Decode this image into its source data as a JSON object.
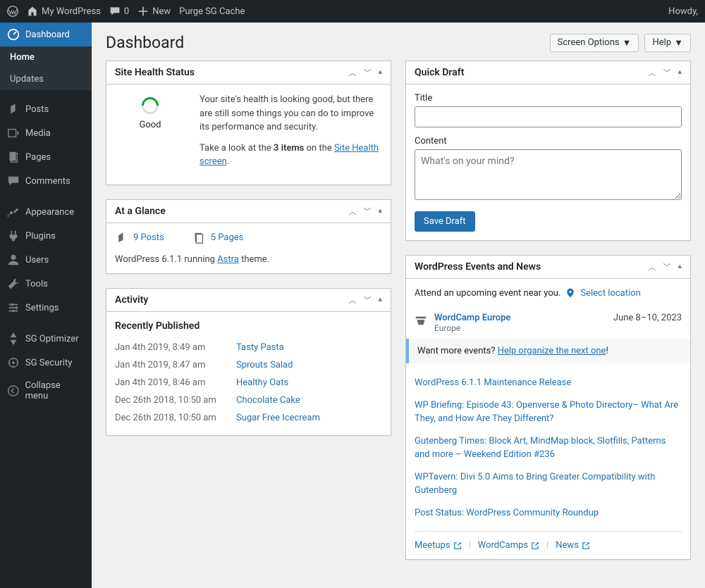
{
  "adminbar": {
    "site_name": "My WordPress",
    "comments_count": "0",
    "new_label": "New",
    "purge_label": "Purge SG Cache",
    "howdy": "Howdy,"
  },
  "sidebar": {
    "dashboard": "Dashboard",
    "home": "Home",
    "updates": "Updates",
    "posts": "Posts",
    "media": "Media",
    "pages": "Pages",
    "comments": "Comments",
    "appearance": "Appearance",
    "plugins": "Plugins",
    "users": "Users",
    "tools": "Tools",
    "settings": "Settings",
    "sg_optimizer": "SG Optimizer",
    "sg_security": "SG Security",
    "collapse": "Collapse menu"
  },
  "page": {
    "title": "Dashboard",
    "screen_options": "Screen Options",
    "help": "Help"
  },
  "site_health": {
    "title": "Site Health Status",
    "status": "Good",
    "p1": "Your site's health is looking good, but there are still some things you can do to improve its performance and security.",
    "p2_prefix": "Take a look at the ",
    "p2_bold": "3 items",
    "p2_mid": " on the ",
    "p2_link": "Site Health screen",
    "p2_suffix": "."
  },
  "glance": {
    "title": "At a Glance",
    "posts": "9 Posts",
    "pages": "5 Pages",
    "wp_prefix": "WordPress 6.1.1 running ",
    "theme": "Astra",
    "wp_suffix": " theme."
  },
  "activity": {
    "title": "Activity",
    "heading": "Recently Published",
    "items": [
      {
        "date": "Jan 4th 2019, 8:49 am",
        "title": "Tasty Pasta"
      },
      {
        "date": "Jan 4th 2019, 8:47 am",
        "title": "Sprouts Salad"
      },
      {
        "date": "Jan 4th 2019, 8:46 am",
        "title": "Healthy Oats"
      },
      {
        "date": "Dec 26th 2018, 10:50 am",
        "title": "Chocolate Cake"
      },
      {
        "date": "Dec 26th 2018, 10:50 am",
        "title": "Sugar Free Icecream"
      }
    ]
  },
  "quick_draft": {
    "title": "Quick Draft",
    "title_label": "Title",
    "content_label": "Content",
    "content_placeholder": "What's on your mind?",
    "save_btn": "Save Draft"
  },
  "events": {
    "title": "WordPress Events and News",
    "attend": "Attend an upcoming event near you.",
    "select_location": "Select location",
    "event_title": "WordCamp Europe",
    "event_location": "Europe",
    "event_date": "June 8–10, 2023",
    "more_prefix": "Want more events? ",
    "more_link": "Help organize the next one",
    "more_suffix": "!",
    "news": [
      "WordPress 6.1.1 Maintenance Release",
      "WP Briefing: Episode 43: Openverse & Photo Directory– What Are They, and How Are They Different?",
      "Gutenberg Times: Block Art, MindMap block, Slotfills, Patterns and more – Weekend Edition #236",
      "WPTavern: Divi 5.0 Aims to Bring Greater Compatibility with Gutenberg",
      "Post Status: WordPress Community Roundup"
    ],
    "footer": {
      "meetups": "Meetups",
      "wordcamps": "WordCamps",
      "news": "News"
    }
  }
}
